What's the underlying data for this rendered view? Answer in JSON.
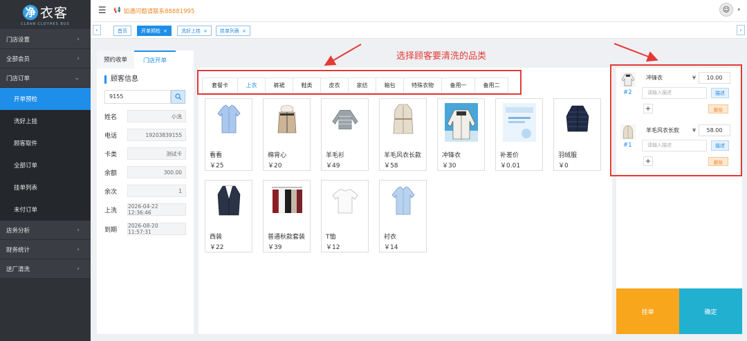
{
  "app": {
    "logo_text": "净衣客",
    "logo_sub": "CLEAN CLOTHES BUS"
  },
  "sidebar": {
    "groups": [
      {
        "label": "门店设置"
      },
      {
        "label": "全部会员"
      },
      {
        "label": "门店订单"
      }
    ],
    "subitems": [
      {
        "label": "开单预检",
        "active": true
      },
      {
        "label": "洗好上挂"
      },
      {
        "label": "顾客取件"
      },
      {
        "label": "全部订单"
      },
      {
        "label": "挂单列表"
      },
      {
        "label": "未付订单"
      }
    ],
    "groups_bottom": [
      {
        "label": "店务分析"
      },
      {
        "label": "财务统计"
      },
      {
        "label": "送厂清洗"
      }
    ]
  },
  "topbar": {
    "notice": "如遇问题请联系88881995",
    "notice_icon": "megaphone-icon"
  },
  "tabs": [
    {
      "label": "首页",
      "closable": false
    },
    {
      "label": "开单预检",
      "active": true,
      "closable": true
    },
    {
      "label": "洗好上挂",
      "closable": true
    },
    {
      "label": "挂单列表",
      "closable": true
    }
  ],
  "panel_tabs": {
    "tab1": "预约收单",
    "tab2": "门店开单"
  },
  "customer": {
    "title": "顾客信息",
    "card_value": "9155",
    "fields": [
      {
        "label": "姓名",
        "value": "小洗"
      },
      {
        "label": "电话",
        "value": "19203839155"
      },
      {
        "label": "卡类",
        "value": "测试卡"
      },
      {
        "label": "余额",
        "value": "300.00"
      },
      {
        "label": "余次",
        "value": "1"
      },
      {
        "label": "上洗",
        "value": "2026-04-22 12:36:46"
      },
      {
        "label": "到期",
        "value": "2026-08-20 11:57:31"
      }
    ]
  },
  "categories": [
    "套餐卡",
    "上衣",
    "裤裙",
    "鞋类",
    "皮衣",
    "家纺",
    "箱包",
    "特殊衣物",
    "备用一",
    "备用二"
  ],
  "active_category": "上衣",
  "annotation": "选择顾客要清洗的品类",
  "products": [
    {
      "name": "看看",
      "price": "￥25",
      "icon": "shirt-icon"
    },
    {
      "name": "棉背心",
      "price": "￥20",
      "icon": "vest-icon"
    },
    {
      "name": "羊毛衫",
      "price": "￥49",
      "icon": "sweater-icon"
    },
    {
      "name": "羊毛风衣长款",
      "price": "￥58",
      "icon": "trenchcoat-icon"
    },
    {
      "name": "冲锋衣",
      "price": "￥30",
      "icon": "jacket-icon"
    },
    {
      "name": "补差价",
      "price": "￥0.01",
      "icon": "card-icon"
    },
    {
      "name": "羽绒服",
      "price": "￥0",
      "icon": "downcoat-icon"
    },
    {
      "name": "西装",
      "price": "￥22",
      "icon": "suit-icon"
    },
    {
      "name": "普通秋款套装",
      "price": "￥39",
      "icon": "clothes-rack-icon"
    },
    {
      "name": "T恤",
      "price": "￥12",
      "icon": "tshirt-icon"
    },
    {
      "name": "衬衣",
      "price": "￥14",
      "icon": "shirt-icon"
    }
  ],
  "order": [
    {
      "num": "#2",
      "name": "冲锋衣",
      "yen": "¥",
      "price": "10.00",
      "desc_placeholder": "请输入描述",
      "desc_btn": "描述",
      "plus": "+",
      "delete": "删除"
    },
    {
      "num": "#1",
      "name": "羊毛风衣长款",
      "yen": "¥",
      "price": "58.00",
      "desc_placeholder": "请输入描述",
      "desc_btn": "描述",
      "plus": "+",
      "delete": "删除"
    }
  ],
  "actions": {
    "hang": "挂单",
    "confirm": "确定"
  },
  "colors": {
    "primary": "#1e8ee8",
    "highlight": "#e53935",
    "hang": "#f8a61c",
    "confirm": "#21b0cf",
    "sidebar": "#2f3338"
  }
}
